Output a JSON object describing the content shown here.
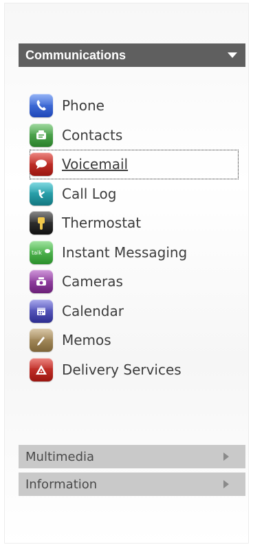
{
  "communications": {
    "title": "Communications",
    "items": [
      {
        "label": "Phone",
        "icon": "phone-icon",
        "color": "#2f5fd0"
      },
      {
        "label": "Contacts",
        "icon": "contacts-icon",
        "color": "#3d9a3d"
      },
      {
        "label": "Voicemail",
        "icon": "voicemail-icon",
        "color": "#c0231c",
        "active": true
      },
      {
        "label": "Call Log",
        "icon": "call-log-icon",
        "color": "#1d9aa5"
      },
      {
        "label": "Thermostat",
        "icon": "thermostat-icon",
        "color": "#2a2a2a"
      },
      {
        "label": "Instant Messaging",
        "icon": "talk-icon",
        "color": "#3fb53f"
      },
      {
        "label": "Cameras",
        "icon": "camera-icon",
        "color": "#8a2f9c"
      },
      {
        "label": "Calendar",
        "icon": "calendar-icon",
        "color": "#4a4ab8"
      },
      {
        "label": "Memos",
        "icon": "memo-icon",
        "color": "#a3885a"
      },
      {
        "label": "Delivery Services",
        "icon": "delivery-icon",
        "color": "#c0231c"
      }
    ]
  },
  "multimedia": {
    "title": "Multimedia"
  },
  "information": {
    "title": "Information"
  },
  "talk_badge": "talk"
}
